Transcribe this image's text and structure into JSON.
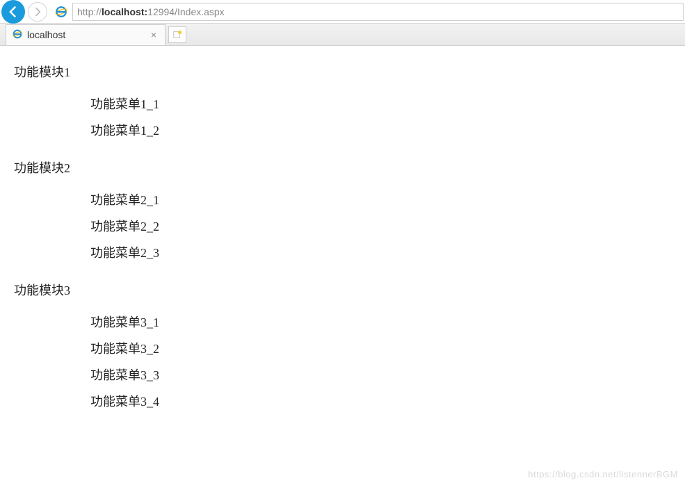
{
  "browser": {
    "url_prefix": "http://",
    "url_host": "localhost:",
    "url_port_path": "12994/Index.aspx",
    "tab_title": "localhost"
  },
  "modules": [
    {
      "title": "功能模块1",
      "items": [
        "功能菜单1_1",
        "功能菜单1_2"
      ]
    },
    {
      "title": "功能模块2",
      "items": [
        "功能菜单2_1",
        "功能菜单2_2",
        "功能菜单2_3"
      ]
    },
    {
      "title": "功能模块3",
      "items": [
        "功能菜单3_1",
        "功能菜单3_2",
        "功能菜单3_3",
        "功能菜单3_4"
      ]
    }
  ],
  "watermark": "https://blog.csdn.net/listennerBGM"
}
